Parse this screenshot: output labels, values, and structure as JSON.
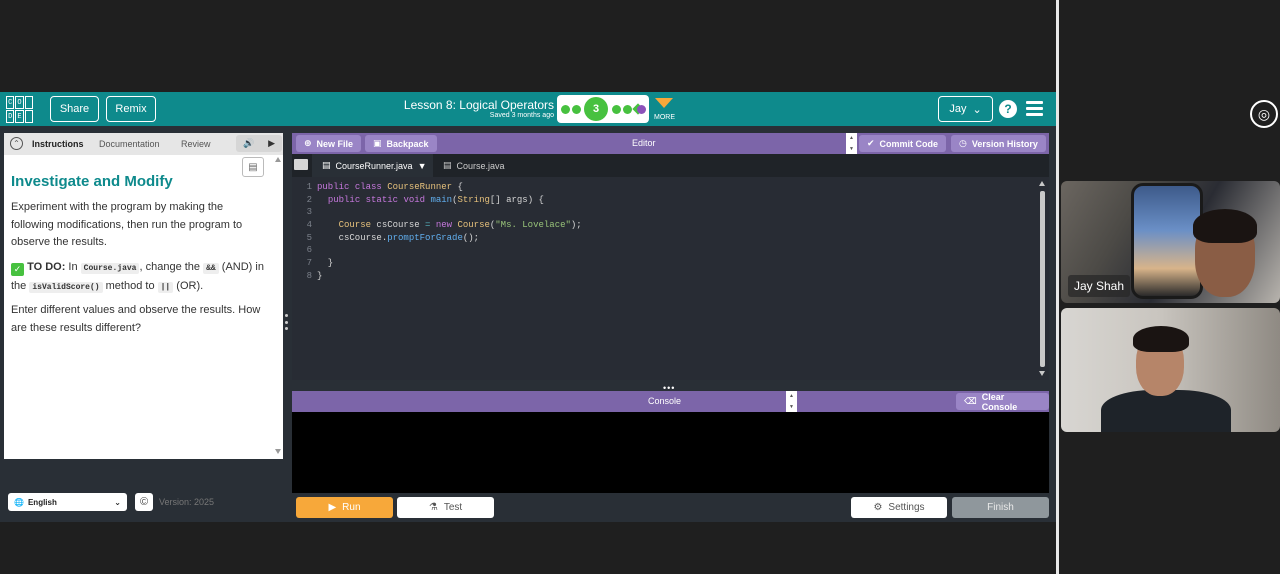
{
  "meeting": {
    "participants": [
      {
        "name": "Jay Shah"
      },
      {
        "name": ""
      }
    ]
  },
  "header": {
    "logo_letters": [
      "C",
      "O",
      "",
      "D",
      "E",
      ""
    ],
    "share_label": "Share",
    "remix_label": "Remix",
    "lesson_title": "Lesson 8: Logical Operators",
    "saved_text": "Saved 3 months ago",
    "progress_current": "3",
    "more_label": "MORE",
    "user_name": "Jay",
    "help_glyph": "?",
    "accent_color": "#0e8a8c"
  },
  "instructions": {
    "tabs": [
      {
        "label": "Instructions",
        "active": true
      },
      {
        "label": "Documentation",
        "active": false
      },
      {
        "label": "Review",
        "active": false
      }
    ],
    "title": "Investigate and Modify",
    "para1": "Experiment with the program by making the following modifications, then run the program to observe the results.",
    "todo_label": "TO DO:",
    "todo_in": "In",
    "todo_file": "Course.java",
    "todo_change": ", change the",
    "todo_and": "&&",
    "todo_and_word": "(AND)",
    "todo_in_the": "in the",
    "todo_method": "isValidScore()",
    "todo_method_to": "method to",
    "todo_or": "||",
    "todo_or_word": "(OR).",
    "para3": "Enter different values and observe the results. How are these results different?"
  },
  "editor": {
    "new_file_label": "New File",
    "backpack_label": "Backpack",
    "title": "Editor",
    "commit_label": "Commit Code",
    "version_label": "Version History",
    "file_tabs": [
      {
        "label": "CourseRunner.java",
        "active": true
      },
      {
        "label": "Course.java",
        "active": false
      }
    ],
    "line_numbers": [
      "1",
      "2",
      "3",
      "4",
      "5",
      "6",
      "7",
      "8"
    ],
    "code": [
      "public class CourseRunner {",
      "  public static void main(String[] args) {",
      "",
      "    Course csCourse = new Course(\"Ms. Lovelace\");",
      "    csCourse.promptForGrade();",
      "",
      "  }",
      "}"
    ]
  },
  "console": {
    "title": "Console",
    "clear_label": "Clear Console"
  },
  "footer": {
    "language": "English",
    "version": "Version: 2025",
    "run_label": "Run",
    "test_label": "Test",
    "settings_label": "Settings",
    "finish_label": "Finish",
    "run_color": "#f7a83a"
  }
}
